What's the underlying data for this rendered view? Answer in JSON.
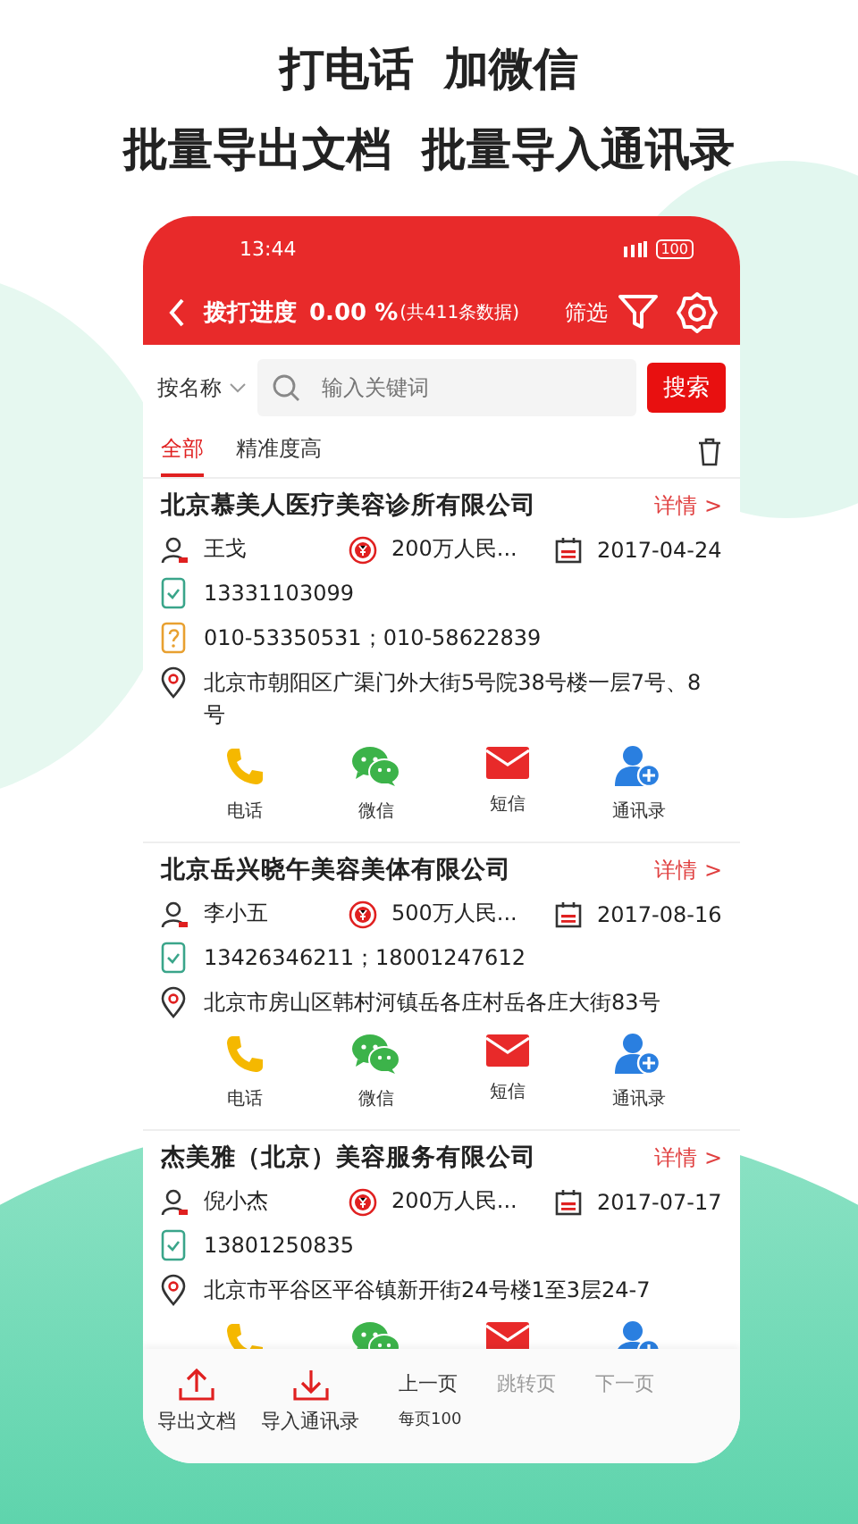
{
  "headline": [
    "打电话  加微信",
    "批量导出文档  批量导入通讯录"
  ],
  "status_bar": {
    "time": "13:44",
    "battery": "100"
  },
  "header": {
    "title": "拨打进度",
    "progress": "0.00 %",
    "count": "(共411条数据)",
    "filter": "筛选"
  },
  "search": {
    "sort": "按名称",
    "placeholder": "输入关键词",
    "button": "搜索"
  },
  "tabs": [
    {
      "label": "全部",
      "selected": true
    },
    {
      "label": "精准度高",
      "selected": false
    }
  ],
  "companies": [
    {
      "name": "北京慕美人医疗美容诊所有限公司",
      "detail": "详情 >",
      "contact": "王戈",
      "capital": "200万人民...",
      "date": "2017-04-24",
      "phones": [
        {
          "kind": "mobile",
          "text": "13331103099"
        },
        {
          "kind": "landline",
          "text": "010-53350531；010-58622839"
        }
      ],
      "address": "北京市朝阳区广渠门外大街5号院38号楼一层7号、8号",
      "actions": [
        {
          "kind": "phone",
          "label": "电话"
        },
        {
          "kind": "wechat",
          "label": "微信"
        },
        {
          "kind": "sms",
          "label": "短信"
        },
        {
          "kind": "contacts",
          "label": "通讯录"
        }
      ]
    },
    {
      "name": "北京岳兴晓午美容美体有限公司",
      "detail": "详情 >",
      "contact": "李小五",
      "capital": "500万人民...",
      "date": "2017-08-16",
      "phones": [
        {
          "kind": "mobile",
          "text": "13426346211；18001247612"
        }
      ],
      "address": "北京市房山区韩村河镇岳各庄村岳各庄大街83号",
      "actions": [
        {
          "kind": "phone",
          "label": "电话"
        },
        {
          "kind": "wechat",
          "label": "微信"
        },
        {
          "kind": "sms",
          "label": "短信"
        },
        {
          "kind": "contacts",
          "label": "通讯录"
        }
      ]
    },
    {
      "name": "杰美雅（北京）美容服务有限公司",
      "detail": "详情 >",
      "contact": "倪小杰",
      "capital": "200万人民...",
      "date": "2017-07-17",
      "phones": [
        {
          "kind": "mobile",
          "text": "13801250835"
        }
      ],
      "address": "北京市平谷区平谷镇新开街24号楼1至3层24-7",
      "actions": [
        {
          "kind": "phone"
        },
        {
          "kind": "wechat"
        },
        {
          "kind": "sms"
        },
        {
          "kind": "contacts"
        }
      ]
    }
  ],
  "bottom_bar": {
    "buttons": [
      {
        "kind": "export",
        "label": "导出文档"
      },
      {
        "kind": "import",
        "label": "导入通讯录"
      }
    ],
    "prev": "上一页",
    "jump": "跳转页",
    "next": "下一页",
    "info": "每页100"
  }
}
